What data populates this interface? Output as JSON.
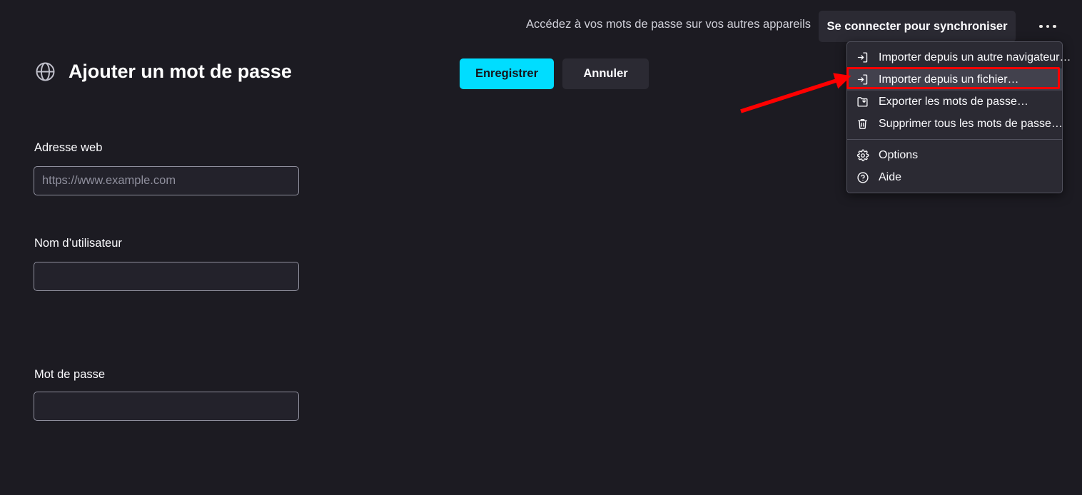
{
  "topbar": {
    "sync_hint": "Accédez à vos mots de passe sur vos autres appareils",
    "signin_label": "Se connecter pour synchroniser",
    "menu_button_icon": "ellipsis-horizontal-icon"
  },
  "page": {
    "icon": "globe-icon",
    "title": "Ajouter un mot de passe"
  },
  "actions": {
    "save_label": "Enregistrer",
    "cancel_label": "Annuler"
  },
  "form": {
    "fields": [
      {
        "label": "Adresse web",
        "value": "",
        "placeholder": "https://www.example.com"
      },
      {
        "label": "Nom d’utilisateur",
        "value": "",
        "placeholder": ""
      },
      {
        "label": "Mot de passe",
        "value": "",
        "placeholder": ""
      }
    ]
  },
  "menu": {
    "items": [
      {
        "label": "Importer depuis un autre navigateur…",
        "icon": "import-arrow-icon",
        "highlighted": false
      },
      {
        "label": "Importer depuis un fichier…",
        "icon": "import-arrow-icon",
        "highlighted": true
      },
      {
        "label": "Exporter les mots de passe…",
        "icon": "export-folder-icon",
        "highlighted": false
      },
      {
        "label": "Supprimer tous les mots de passe…",
        "icon": "trash-icon",
        "highlighted": false
      },
      {
        "label": "Options",
        "icon": "gear-icon",
        "highlighted": false
      },
      {
        "label": "Aide",
        "icon": "question-circle-icon",
        "highlighted": false
      }
    ]
  },
  "annotation": {
    "box_color": "#ff0000",
    "arrow_color": "#ff0000",
    "target": "Importer depuis un fichier…"
  },
  "colors": {
    "background": "#1c1b22",
    "accent": "#00ddff",
    "surface": "#2b2a33",
    "highlight": "#42414d",
    "text": "#fbfbfe",
    "muted_text": "#8f8f9d",
    "border": "#52525e"
  }
}
